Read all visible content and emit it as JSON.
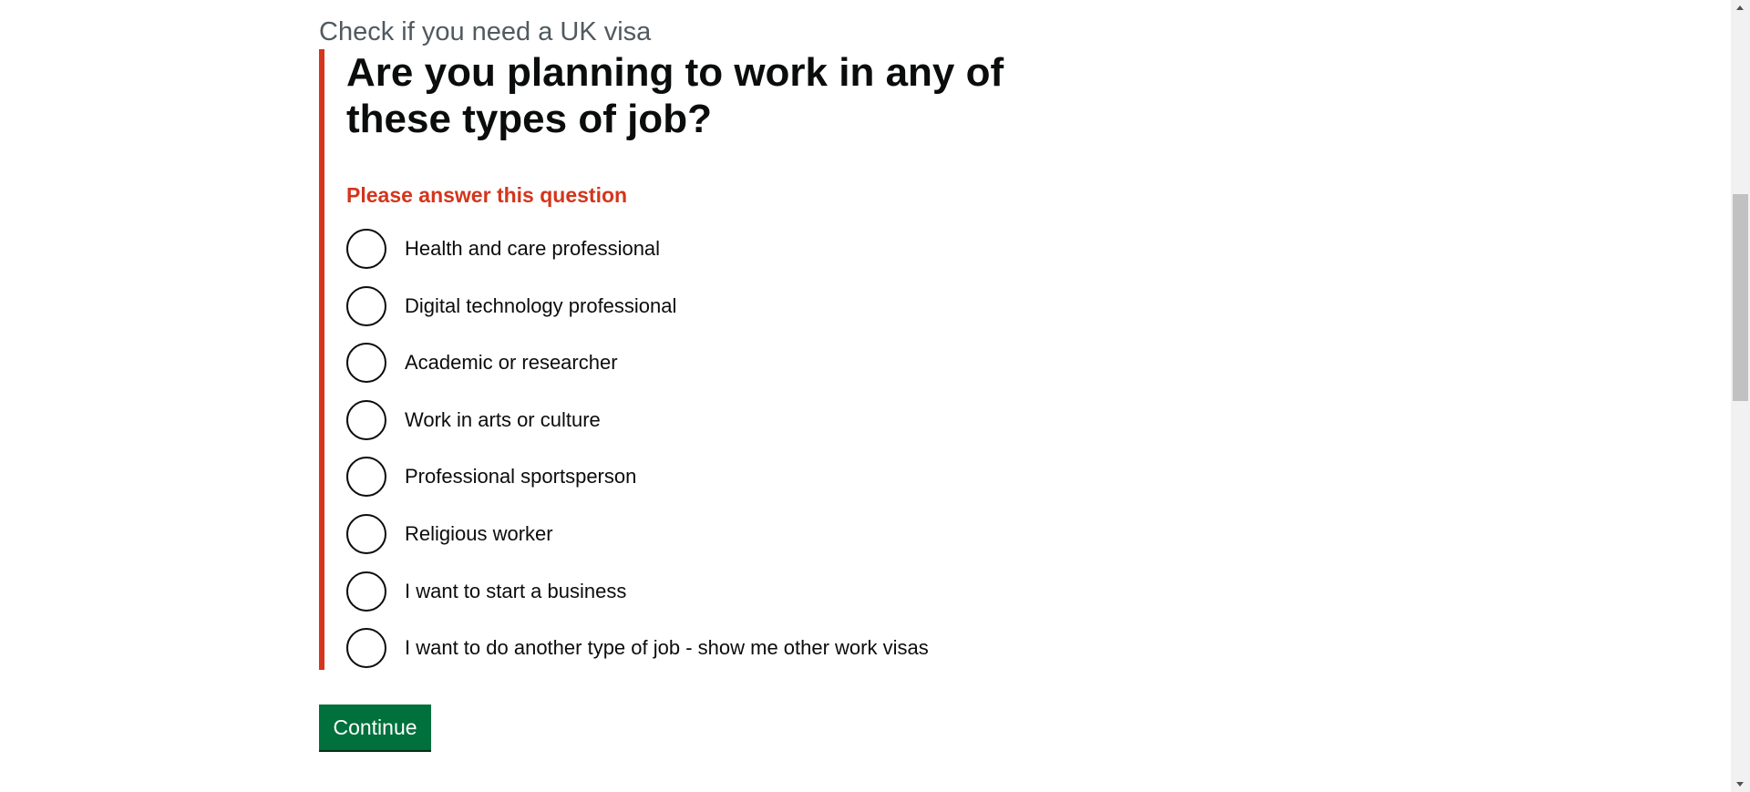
{
  "caption": "Check if you need a UK visa",
  "question": {
    "heading": "Are you planning to work in any of these types of job?",
    "error_message": "Please answer this question",
    "options": [
      {
        "label": "Health and care professional"
      },
      {
        "label": "Digital technology professional"
      },
      {
        "label": "Academic or researcher"
      },
      {
        "label": "Work in arts or culture"
      },
      {
        "label": "Professional sportsperson"
      },
      {
        "label": "Religious worker"
      },
      {
        "label": "I want to start a business"
      },
      {
        "label": "I want to do another type of job - show me other work visas"
      }
    ]
  },
  "actions": {
    "continue_label": "Continue"
  },
  "colors": {
    "error": "#d4351c",
    "button": "#00703c",
    "text": "#0b0c0c",
    "caption": "#505a5f"
  }
}
